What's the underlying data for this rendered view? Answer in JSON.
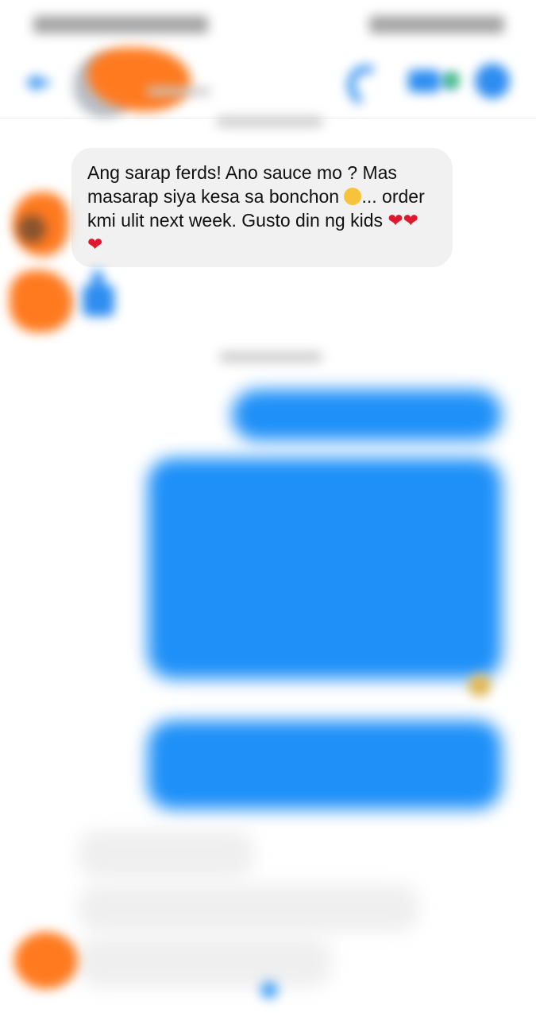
{
  "header": {
    "call_icon": "phone-icon",
    "video_icon": "video-camera-icon",
    "info_icon": "info-icon",
    "back_icon": "back-arrow-icon"
  },
  "messages": {
    "incoming_clear": {
      "line1": "Ang sarap ferds! Ano sauce mo ? Mas masarap siya kesa sa bonchon ",
      "line2": "... order kmi ulit next week. Gusto din ng kids ",
      "hearts_inline": "❤❤",
      "heart_end": "❤"
    }
  },
  "colors": {
    "accent": "#2d8df0",
    "outgoing_bubble": "#1e90f8",
    "incoming_bubble": "#f1f1f1",
    "redaction": "#ff7a1f"
  }
}
